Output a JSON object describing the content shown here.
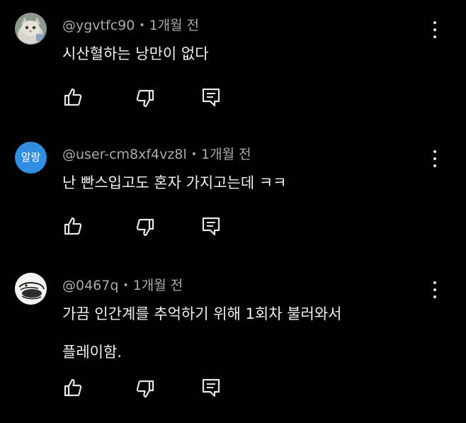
{
  "comments": [
    {
      "author": "@ygvtfc90",
      "separator": "•",
      "time": "1개월 전",
      "lines": [
        "시산혈하는 낭만이 없다"
      ],
      "avatar_icon": "cat-photo-icon"
    },
    {
      "author": "@user-cm8xf4vz8l",
      "separator": "•",
      "time": "1개월 전",
      "lines": [
        "난 빤스입고도 혼자 가지고는데 ㅋㅋ"
      ],
      "avatar_text": "알랑",
      "avatar_color": "#2f8ee0"
    },
    {
      "author": "@0467q",
      "separator": "•",
      "time": "1개월 전",
      "lines": [
        "가끔 인간계를 추억하기 위해 1회차 불러와서",
        "플레이함."
      ],
      "avatar_icon": "sketch-drawing-icon"
    }
  ],
  "actions": {
    "like_icon": "thumbs-up-icon",
    "dislike_icon": "thumbs-down-icon",
    "reply_icon": "reply-comment-icon",
    "more_icon": "more-vert-icon"
  },
  "colors": {
    "background": "#000000",
    "text": "#f1f1f1",
    "meta_text": "#aaaaaa",
    "icon": "#e8e8e8"
  }
}
